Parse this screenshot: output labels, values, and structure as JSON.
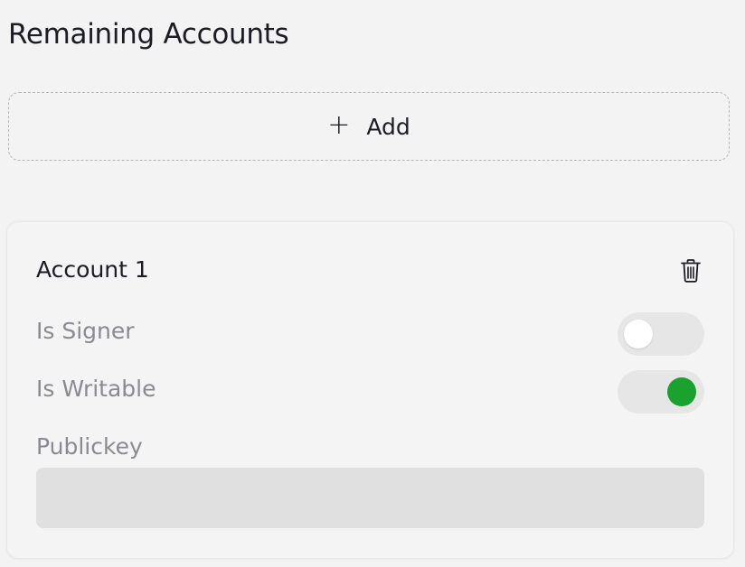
{
  "section": {
    "title": "Remaining Accounts"
  },
  "add_button": {
    "icon": "plus-icon",
    "icon_glyph": "+",
    "label": "Add"
  },
  "account": {
    "title": "Account 1",
    "delete_icon": "trash-icon",
    "is_signer": {
      "label": "Is Signer",
      "checked": false
    },
    "is_writable": {
      "label": "Is Writable",
      "checked": true
    },
    "publickey": {
      "label": "Publickey",
      "value": "",
      "placeholder": ""
    }
  },
  "colors": {
    "background": "#f3f3f3",
    "card": "#f4f4f4",
    "toggle_track": "#e6e6e6",
    "toggle_on": "#1aa12e",
    "input_bg": "#e0e0e0",
    "muted_text": "#8a8a92",
    "text": "#1c1c24"
  }
}
